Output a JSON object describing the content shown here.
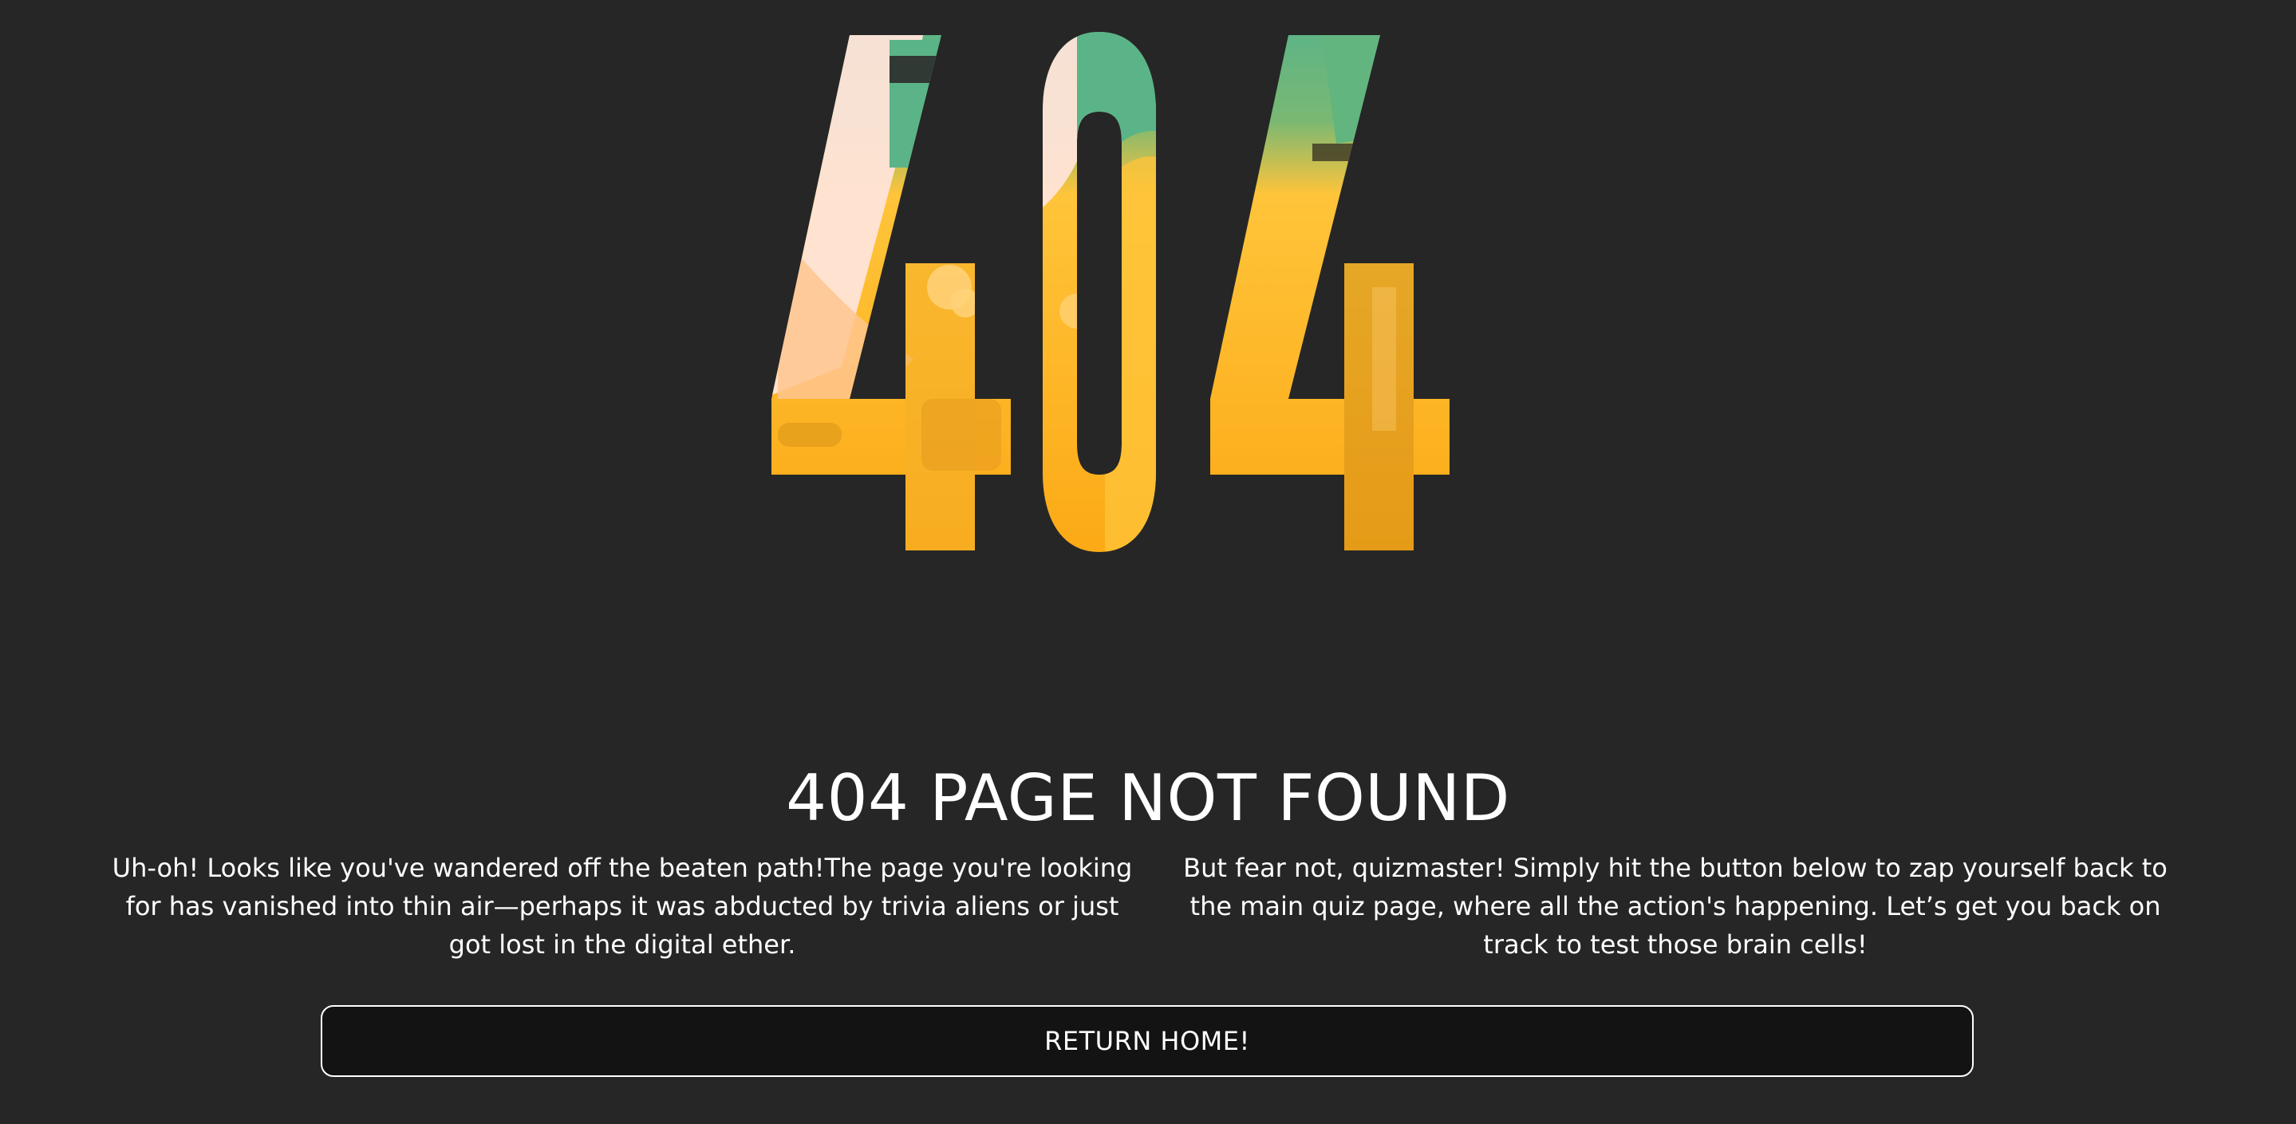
{
  "hero": {
    "code": "404",
    "colors": {
      "green": "#5bb488",
      "yellow": "#ffc43a",
      "orange": "#fca915",
      "peach": "#ffe4d8",
      "background": "#262626"
    }
  },
  "title": "404 PAGE NOT FOUND",
  "messages": {
    "left": "Uh-oh! Looks like you've wandered off the beaten path!The page you're looking for has vanished into thin air—perhaps it was abducted by trivia aliens or just got lost in the digital ether.",
    "right": "But fear not, quizmaster! Simply hit the button below to zap yourself back to the main quiz page, where all the action's happening. Let’s get you back on track to test those brain cells!"
  },
  "button": {
    "label": "RETURN HOME!",
    "border_color": "#ffffff",
    "background": "#131313"
  }
}
